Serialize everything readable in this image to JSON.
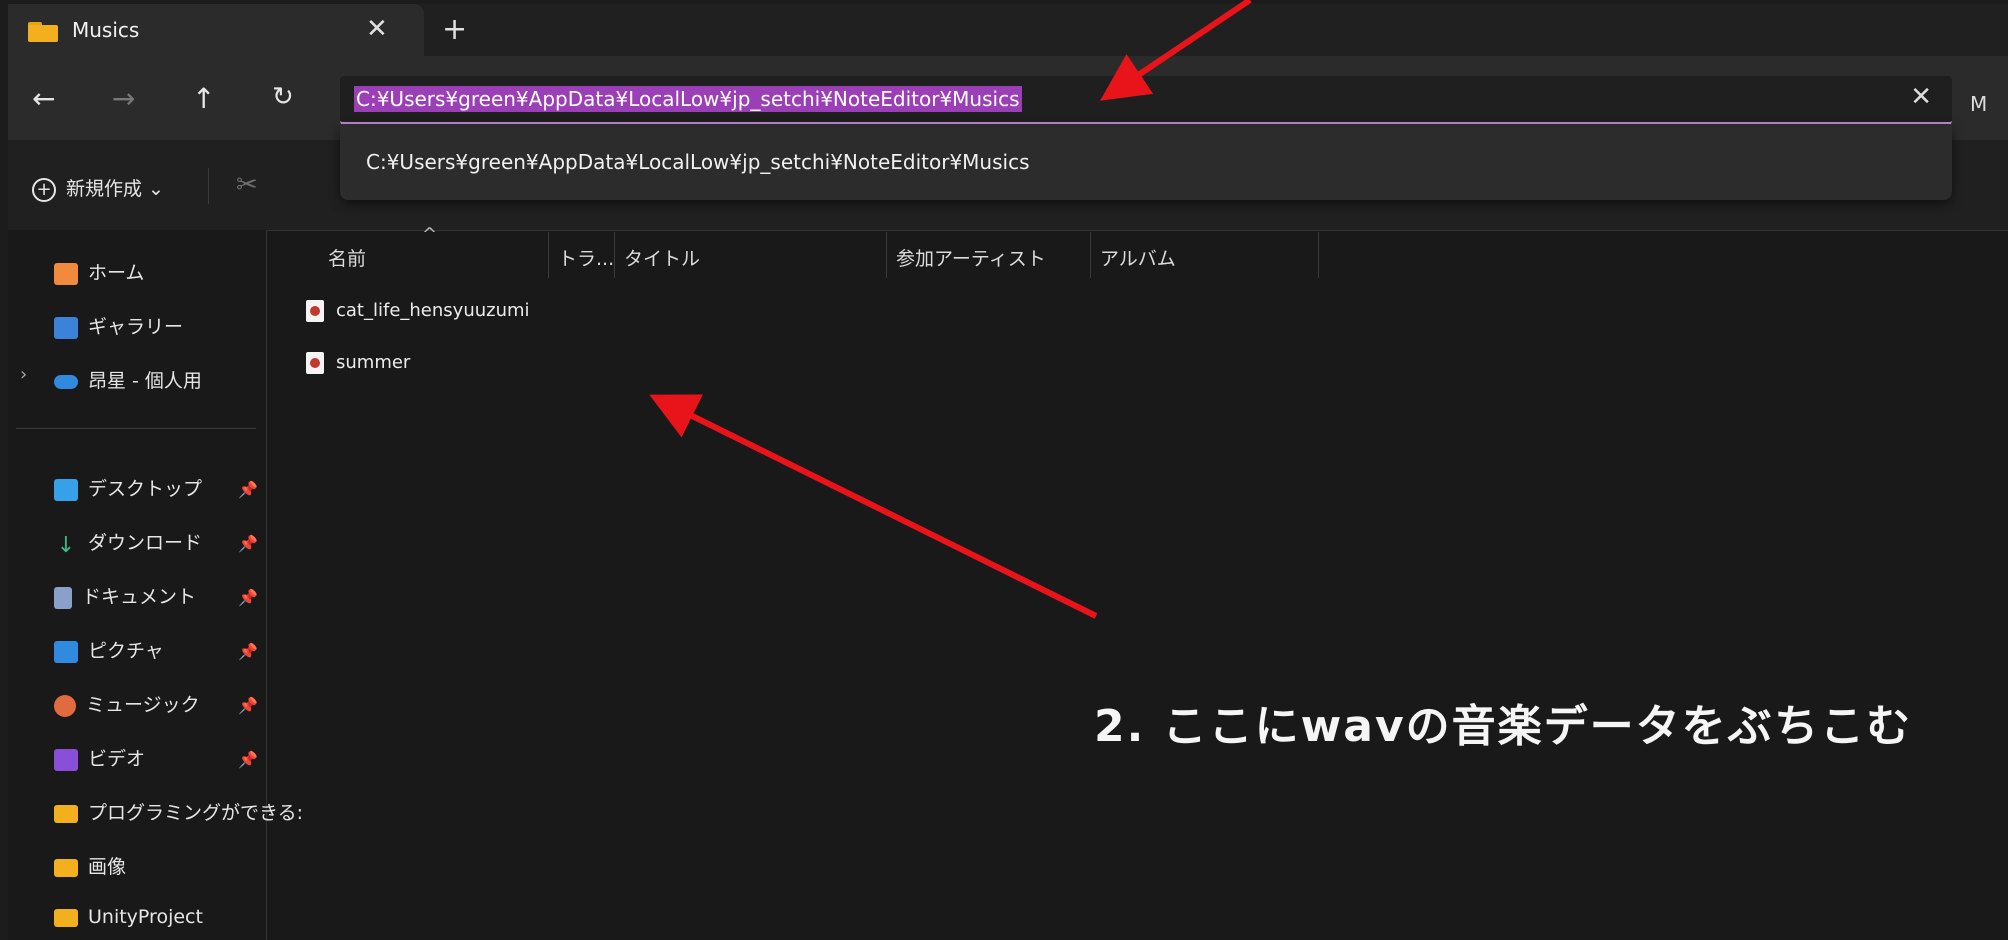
{
  "tab": {
    "title": "Musics"
  },
  "nav": {
    "right_text": "M"
  },
  "address": {
    "path": "C:¥Users¥green¥AppData¥LocalLow¥jp_setchi¥NoteEditor¥Musics",
    "suggestion": "C:¥Users¥green¥AppData¥LocalLow¥jp_setchi¥NoteEditor¥Musics"
  },
  "toolbar": {
    "new_label": "新規作成"
  },
  "sidebar": {
    "items": [
      {
        "label": "ホーム",
        "icon": "home-icon",
        "color": "#f08a3c"
      },
      {
        "label": "ギャラリー",
        "icon": "gallery-icon",
        "color": "#3b82d8"
      },
      {
        "label": "昂星 - 個人用",
        "icon": "cloud-icon",
        "color": "#2f8ae0"
      },
      {
        "label": "デスクトップ",
        "icon": "desktop-icon",
        "color": "#36a0e8"
      },
      {
        "label": "ダウンロード",
        "icon": "download-icon",
        "color": "#3fb887"
      },
      {
        "label": "ドキュメント",
        "icon": "document-icon",
        "color": "#8aa0c8"
      },
      {
        "label": "ピクチャ",
        "icon": "picture-icon",
        "color": "#2f8ae0"
      },
      {
        "label": "ミュージック",
        "icon": "music-icon",
        "color": "#e26a3f"
      },
      {
        "label": "ビデオ",
        "icon": "video-icon",
        "color": "#8a4fd8"
      },
      {
        "label": "プログラミングができる:",
        "icon": "folder-icon",
        "color": "#f2b01e"
      },
      {
        "label": "画像",
        "icon": "folder-icon",
        "color": "#f2b01e"
      },
      {
        "label": "UnityProject",
        "icon": "folder-icon",
        "color": "#f2b01e"
      }
    ]
  },
  "columns": {
    "name": "名前",
    "track": "トラ...",
    "title": "タイトル",
    "artist": "参加アーティスト",
    "album": "アルバム"
  },
  "files": [
    "cat_life_hensyuuzumi",
    "summer"
  ],
  "annotation": "2. ここにwavの音楽データをぶちこむ",
  "colors": {
    "accent": "#c08ad6",
    "highlight": "#9b3fb6",
    "arrow": "#e8141a"
  }
}
